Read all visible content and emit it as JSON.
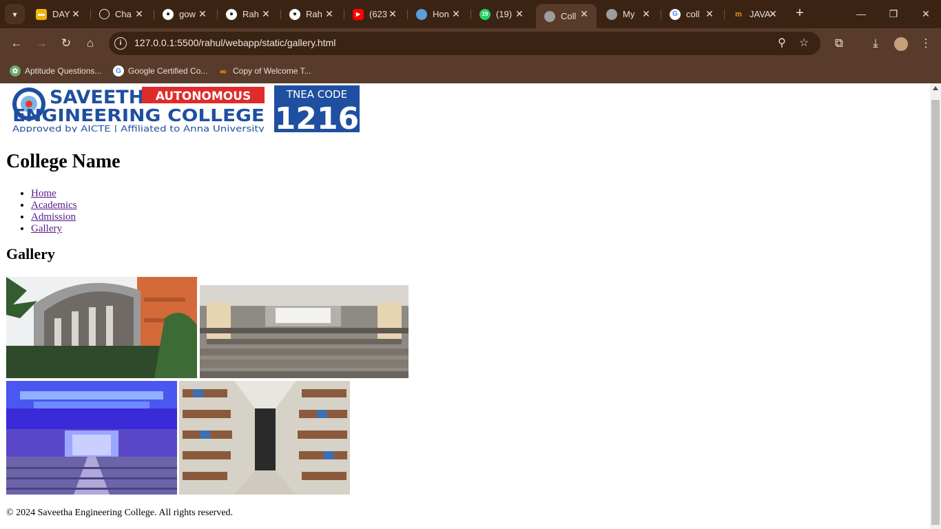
{
  "browser": {
    "tabs": [
      {
        "title": "DAY",
        "icon": "sheets-icon",
        "color": "#f4b400"
      },
      {
        "title": "Cha",
        "icon": "chatgpt-icon",
        "color": "#e8e8e8"
      },
      {
        "title": "gow",
        "icon": "github-icon",
        "color": "#ffffff"
      },
      {
        "title": "Rah",
        "icon": "github-icon",
        "color": "#ffffff"
      },
      {
        "title": "Rah",
        "icon": "github-icon",
        "color": "#ffffff"
      },
      {
        "title": "(623",
        "icon": "youtube-icon",
        "color": "#ff0000"
      },
      {
        "title": "Hon",
        "icon": "globe-icon",
        "color": "#5aa0d8"
      },
      {
        "title": "(19)",
        "icon": "whatsapp-icon",
        "color": "#25d366",
        "badge": "19"
      },
      {
        "title": "Coll",
        "icon": "globe-icon",
        "color": "#cfcfcf",
        "active": true
      },
      {
        "title": "My",
        "icon": "globe-icon",
        "color": "#cfcfcf"
      },
      {
        "title": "coll",
        "icon": "google-icon",
        "color": "#ffffff"
      },
      {
        "title": "JAVA",
        "icon": "naukri-icon",
        "color": "#f08a24"
      }
    ],
    "url": "127.0.0.1:5500/rahul/webapp/static/gallery.html",
    "bookmarks": [
      {
        "label": "Aptitude Questions...",
        "icon": "leaf-icon"
      },
      {
        "label": "Google Certified Co...",
        "icon": "google-icon"
      },
      {
        "label": "Copy of Welcome T...",
        "icon": "colab-icon"
      }
    ]
  },
  "page": {
    "logo": {
      "line1": "SAVEETHA",
      "badge": "AUTONOMOUS",
      "line2": "ENGINEERING COLLEGE",
      "line3": "Approved by AICTE  |  Affiliated to Anna University",
      "code_label": "TNEA CODE",
      "code": "1216"
    },
    "heading": "College Name",
    "nav": [
      "Home",
      "Academics",
      "Admission",
      "Gallery"
    ],
    "section_title": "Gallery",
    "photos": [
      "campus-building-photo",
      "classroom-photo",
      "auditorium-photo",
      "library-photo"
    ],
    "footer": "© 2024 Saveetha Engineering College. All rights reserved."
  }
}
